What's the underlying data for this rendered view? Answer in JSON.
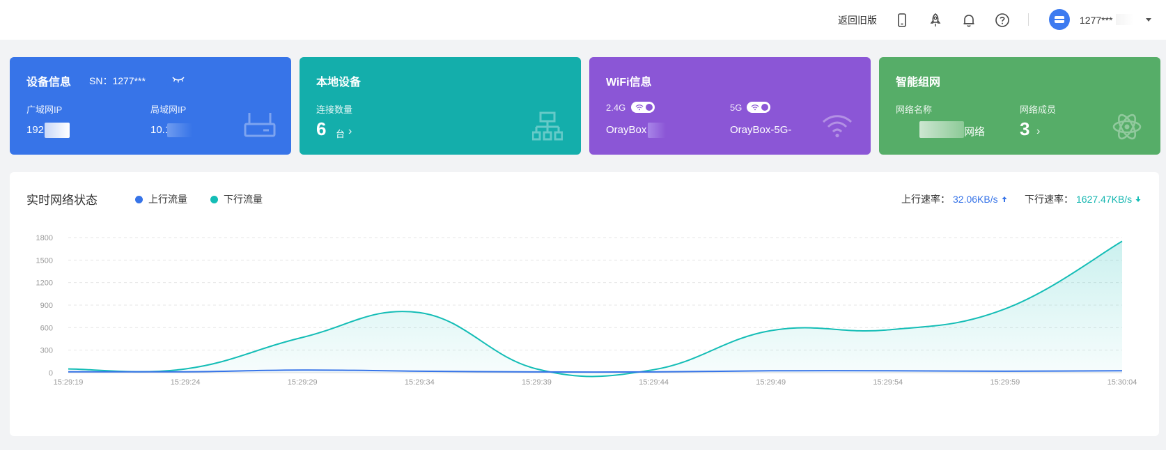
{
  "header": {
    "old_version_label": "返回旧版",
    "user_name": "1277***"
  },
  "cards": {
    "device": {
      "title": "设备信息",
      "sn_label": "SN：1277***",
      "wan_label": "广域网IP",
      "wan_value": "192",
      "lan_label": "局域网IP",
      "lan_value": "10.1"
    },
    "local": {
      "title": "本地设备",
      "count_label": "连接数量",
      "count": "6",
      "unit": "台"
    },
    "wifi": {
      "title": "WiFi信息",
      "band1": "2.4G",
      "band1_ssid": "OrayBox",
      "band2": "5G",
      "band2_ssid": "OrayBox-5G-"
    },
    "mesh": {
      "title": "智能组网",
      "name_label": "网络名称",
      "name_value": "网络",
      "members_label": "网络成员",
      "members": "3"
    }
  },
  "panel": {
    "title": "实时网络状态",
    "legend_up": "上行流量",
    "legend_down": "下行流量",
    "up_rate_label": "上行速率：",
    "up_rate_value": "32.06KB/s",
    "down_rate_label": "下行速率：",
    "down_rate_value": "1627.47KB/s"
  },
  "colors": {
    "up": "#3774e8",
    "down": "#14bdb6"
  },
  "chart_data": {
    "type": "area",
    "x": [
      "15:29:19",
      "15:29:24",
      "15:29:29",
      "15:29:34",
      "15:29:39",
      "15:29:44",
      "15:29:49",
      "15:29:54",
      "15:29:59",
      "15:30:04"
    ],
    "series": [
      {
        "name": "上行流量",
        "values": [
          12,
          12,
          35,
          20,
          10,
          10,
          25,
          25,
          20,
          25
        ]
      },
      {
        "name": "下行流量",
        "values": [
          50,
          50,
          470,
          800,
          50,
          40,
          560,
          570,
          850,
          1750
        ]
      }
    ],
    "ylim": [
      0,
      1800
    ],
    "yticks": [
      0,
      300,
      600,
      900,
      1200,
      1500,
      1800
    ],
    "grid": true,
    "legend_position": "top-left"
  }
}
